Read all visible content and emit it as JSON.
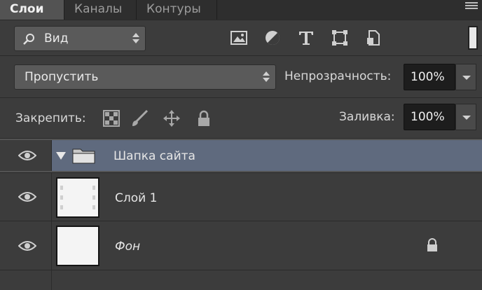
{
  "tabs": [
    {
      "label": "Слои",
      "active": true
    },
    {
      "label": "Каналы",
      "active": false
    },
    {
      "label": "Контуры",
      "active": false
    }
  ],
  "filter": {
    "kind_label": "Вид",
    "icons": [
      "image-filter-icon",
      "adjustment-filter-icon",
      "type-filter-icon",
      "shape-filter-icon",
      "smart-object-filter-icon"
    ]
  },
  "blend": {
    "mode": "Пропустить",
    "opacity_label": "Непрозрачность:",
    "opacity_value": "100%"
  },
  "lock": {
    "label": "Закрепить:",
    "icons": [
      "lock-transparency-icon",
      "lock-image-icon",
      "lock-position-icon",
      "lock-all-icon"
    ],
    "fill_label": "Заливка:",
    "fill_value": "100%"
  },
  "layers": [
    {
      "name": "Шапка сайта",
      "type": "group",
      "visible": true,
      "selected": true
    },
    {
      "name": "Слой 1",
      "type": "layer",
      "visible": true,
      "selected": false
    },
    {
      "name": "Фон",
      "type": "background",
      "visible": true,
      "selected": false,
      "locked": true
    }
  ],
  "colors": {
    "panel": "#535353",
    "row": "#3c3c3c",
    "selected": "#5f6a7e",
    "input": "#1d1d1d"
  }
}
